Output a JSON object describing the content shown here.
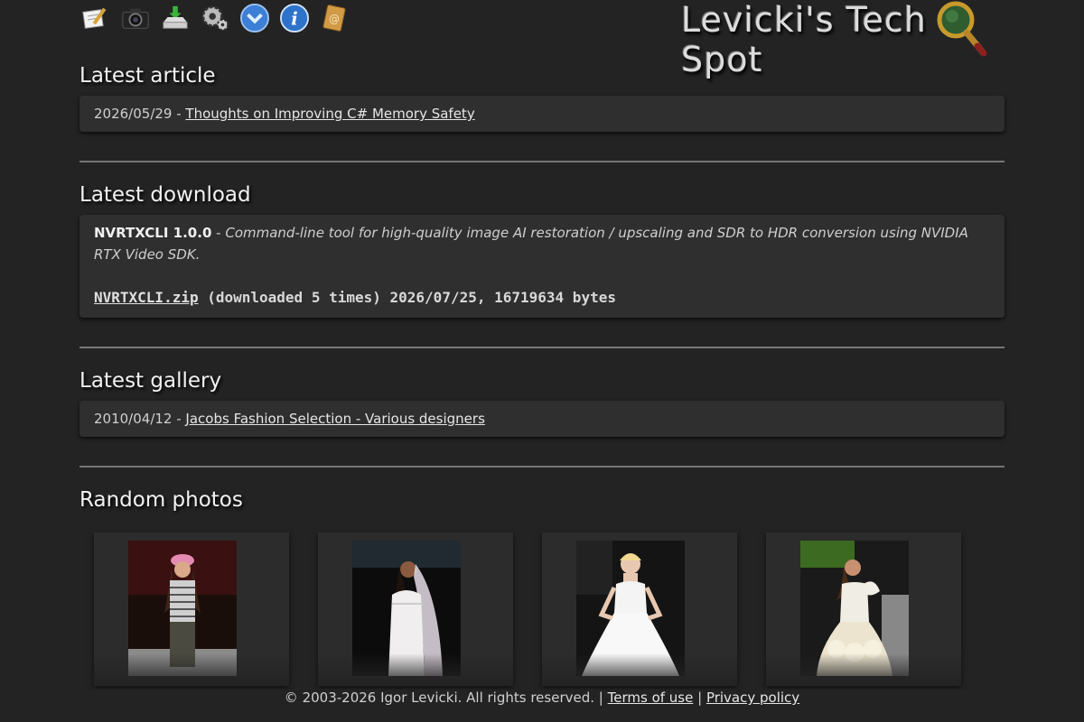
{
  "header": {
    "site_title": "Levicki's Tech Spot",
    "nav_icons": [
      "notes-icon",
      "camera-icon",
      "download-icon",
      "settings-icon",
      "shield-icon",
      "info-icon",
      "contact-book-icon"
    ]
  },
  "latest_article": {
    "heading": "Latest article",
    "date": "2026/05/29",
    "separator": " - ",
    "link_text": "Thoughts on Improving C# Memory Safety"
  },
  "latest_download": {
    "heading": "Latest download",
    "name": "NVRTXCLI 1.0.0",
    "separator": " - ",
    "description": "Command-line tool for high-quality image AI restoration / upscaling and SDR to HDR conversion using NVIDIA RTX Video SDK.",
    "file_link": "NVRTXCLI.zip",
    "file_info": " (downloaded 5 times) 2026/07/25, 16719634 bytes"
  },
  "latest_gallery": {
    "heading": "Latest gallery",
    "date": "2010/04/12",
    "separator": " - ",
    "link_text": "Jacobs Fashion Selection - Various designers"
  },
  "random_photos": {
    "heading": "Random photos"
  },
  "footer": {
    "copyright": "© 2003-2026 Igor Levicki. All rights reserved.",
    "divider1": " | ",
    "terms": "Terms of use",
    "divider2": " | ",
    "privacy": "Privacy policy"
  },
  "colors": {
    "background": "#232323",
    "card": "#2f2f2f",
    "text": "#d8d8d8"
  }
}
